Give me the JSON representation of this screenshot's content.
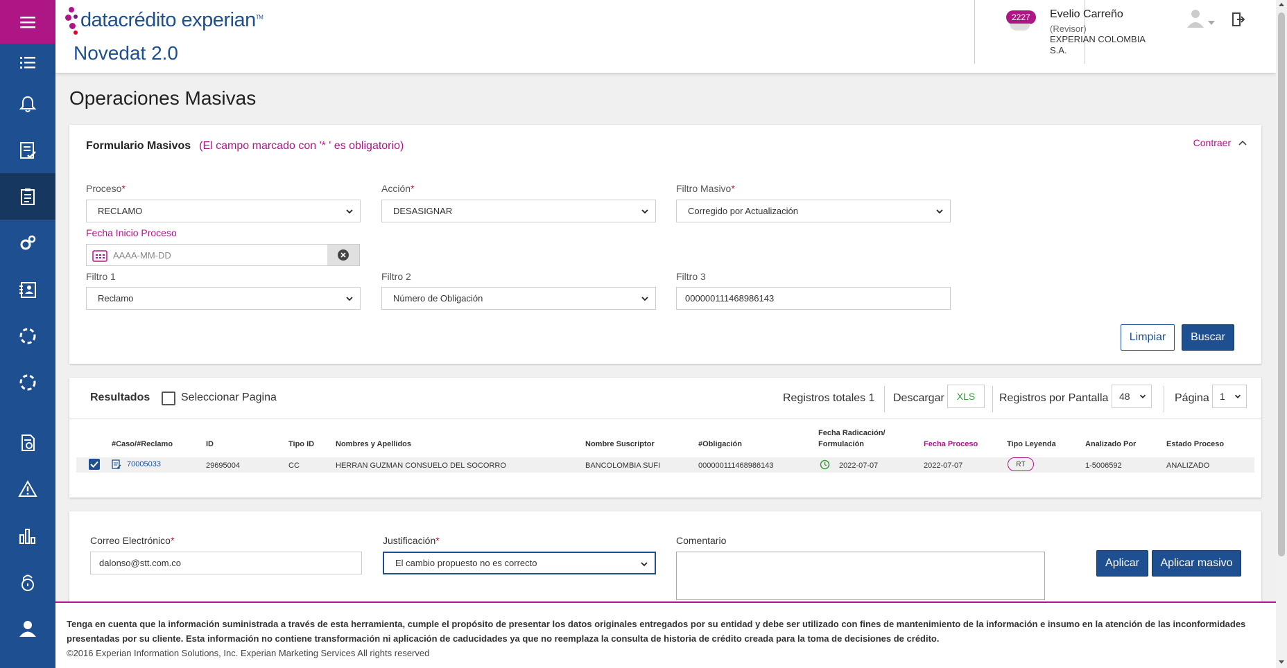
{
  "header": {
    "logo_text": "datacrédito experian",
    "logo_tm": "TM",
    "app_title": "Novedat 2.0",
    "notification_count": "2227",
    "user_name": "Evelio Carreño",
    "user_role": "(Revisor)",
    "user_company": "EXPERIAN COLOMBIA S.A."
  },
  "page_title": "Operaciones Masivas",
  "form": {
    "title": "Formulario Masivos",
    "required_note": "(El campo marcado con '* ' es obligatorio)",
    "collapse_label": "Contraer",
    "proceso_label": "Proceso",
    "proceso_value": "RECLAMO",
    "accion_label": "Acción",
    "accion_value": "DESASIGNAR",
    "filtro_masivo_label": "Filtro Masivo",
    "filtro_masivo_value": "Corregido por Actualización",
    "fecha_label": "Fecha Inicio Proceso",
    "fecha_placeholder": "AAAA-MM-DD",
    "filtro1_label": "Filtro 1",
    "filtro1_value": "Reclamo",
    "filtro2_label": "Filtro 2",
    "filtro2_value": "Número de Obligación",
    "filtro3_label": "Filtro 3",
    "filtro3_value": "000000111468986143",
    "limpiar_label": "Limpiar",
    "buscar_label": "Buscar",
    "required_mark": "*"
  },
  "results": {
    "title": "Resultados",
    "select_page_label": "Seleccionar Pagina",
    "total_label": "Registros totales 1",
    "download_label": "Descargar",
    "xls_label": "XLS",
    "per_page_label": "Registros por Pantalla",
    "per_page_value": "48",
    "page_label": "Página",
    "page_value": "1",
    "columns": [
      "#Caso/#Reclamo",
      "ID",
      "Tipo ID",
      "Nombres y Apellidos",
      "Nombre Suscriptor",
      "#Obligación",
      "Fecha Radicación/",
      "Formulación",
      "Fecha Proceso",
      "Tipo Leyenda",
      "Analizado Por",
      "Estado Proceso"
    ],
    "row": {
      "caso": "70005033",
      "id": "29695004",
      "tipo_id": "CC",
      "nombre": "HERRAN GUZMAN CONSUELO DEL SOCORRO",
      "suscriptor": "BANCOLOMBIA SUFI",
      "obligacion": "000000111468986143",
      "fecha_radicacion": "2022-07-07",
      "fecha_proceso": "2022-07-07",
      "tipo_leyenda": "RT",
      "analizado_por": "1-5006592",
      "estado": "ANALIZADO"
    }
  },
  "apply": {
    "correo_label": "Correo Electrónico",
    "correo_value": "dalonso@stt.com.co",
    "justificacion_label": "Justificación",
    "justificacion_value": "El cambio propuesto no es correcto",
    "comentario_label": "Comentario",
    "aplicar_label": "Aplicar",
    "aplicar_masivo_label": "Aplicar masivo"
  },
  "footer": {
    "disclaimer_line1": "Tenga en cuenta que la información suministrada a través de esta herramienta, cumple el propósito de presentar los datos originales entregados por su entidad y debe ser utilizado con fines de mantenimiento de la información e insumo en la atención de las inconformidades",
    "disclaimer_line2": "presentadas por su cliente. Esta información no contiene transformación ni aplicación de caducidades ya que no reemplaza la consulta de historia de crédito creada para la toma de decisiones de crédito.",
    "copyright": "©2016 Experian Information Solutions, Inc. Experian Marketing Services All rights reserved"
  },
  "colors": {
    "brand_blue": "#1d4f91",
    "brand_magenta": "#af1685",
    "sidebar_active": "#16375f"
  },
  "icons": {
    "sidebar": [
      "menu-icon",
      "list-icon",
      "bell-icon",
      "checklist-icon",
      "clipboard-icon",
      "gears-icon",
      "contact-card-icon",
      "loading-circle-icon",
      "loading-circle-icon",
      "document-sync-icon",
      "warning-icon",
      "chart-icon",
      "lock-icon",
      "user-icon"
    ]
  }
}
